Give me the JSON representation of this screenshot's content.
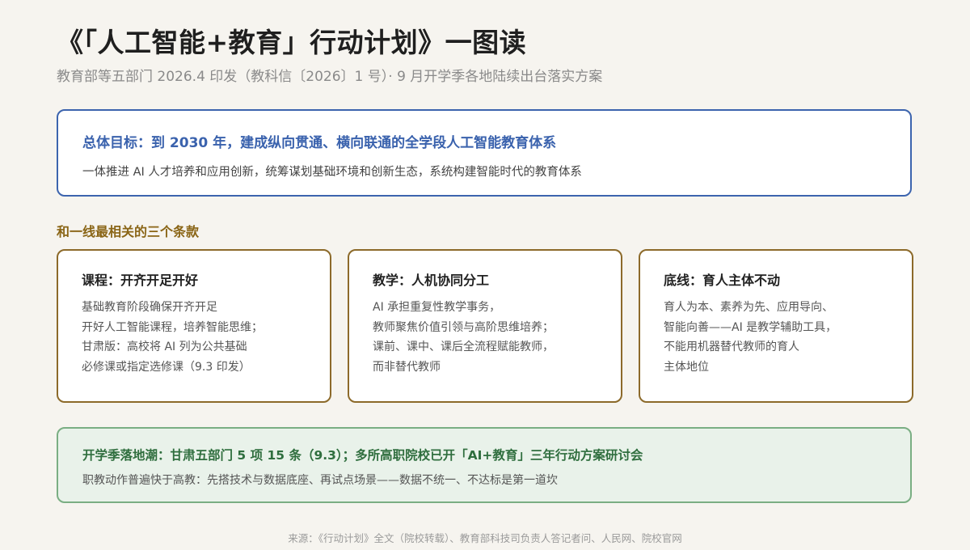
{
  "header": {
    "title": "《「人工智能+教育」行动计划》一图读",
    "subtitle": "教育部等五部门 2026.4 印发（教科信〔2026〕1 号）· 9 月开学季各地陆续出台落实方案"
  },
  "goal": {
    "title": "总体目标：到 2030 年，建成纵向贯通、横向联通的全学段人工智能教育体系",
    "desc": "一体推进 AI 人才培养和应用创新，统筹谋划基础环境和创新生态，系统构建智能时代的教育体系"
  },
  "section": {
    "heading": "和一线最相关的三个条款"
  },
  "clauses": [
    {
      "title": "课程：开齐开足开好",
      "lines": [
        "基础教育阶段确保开齐开足",
        "开好人工智能课程，培养智能思维；",
        "甘肃版：高校将 AI 列为公共基础",
        "必修课或指定选修课（9.3 印发）"
      ]
    },
    {
      "title": "教学：人机协同分工",
      "lines": [
        "AI 承担重复性教学事务，",
        "教师聚焦价值引领与高阶思维培养；",
        "课前、课中、课后全流程赋能教师，",
        "而非替代教师"
      ]
    },
    {
      "title": "底线：育人主体不动",
      "lines": [
        "育人为本、素养为先、应用导向、",
        "智能向善——AI 是教学辅助工具，",
        "不能用机器替代教师的育人",
        "主体地位"
      ]
    }
  ],
  "landing": {
    "title": "开学季落地潮：甘肃五部门 5 项 15 条（9.3）；多所高职院校已开「AI+教育」三年行动方案研讨会",
    "desc": "职教动作普遍快于高教：先搭技术与数据底座、再试点场景——数据不统一、不达标是第一道坎"
  },
  "footer": {
    "source": "来源：《行动计划》全文（院校转载）、教育部科技司负责人答记者问、人民网、院校官网"
  },
  "colors": {
    "background": "#f6f4ef",
    "goal_accent": "#3c64ae",
    "clause_accent": "#8c6a2a",
    "landing_accent": "#2f6e3e",
    "landing_bg": "#e9f2ea"
  }
}
